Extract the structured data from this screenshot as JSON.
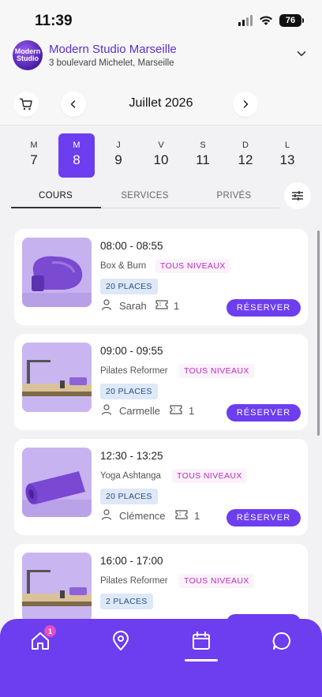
{
  "status": {
    "time": "11:39",
    "battery": "76"
  },
  "studio": {
    "name": "Modern Studio Marseille",
    "address": "3 boulevard Michelet, Marseille",
    "logo_line1": "Modern",
    "logo_line2": "Studio"
  },
  "calendar": {
    "month": "Juillet 2026",
    "days": [
      {
        "name": "M",
        "num": "7",
        "active": false
      },
      {
        "name": "M",
        "num": "8",
        "active": true
      },
      {
        "name": "J",
        "num": "9",
        "active": false
      },
      {
        "name": "V",
        "num": "10",
        "active": false
      },
      {
        "name": "S",
        "num": "11",
        "active": false
      },
      {
        "name": "D",
        "num": "12",
        "active": false
      },
      {
        "name": "L",
        "num": "13",
        "active": false
      }
    ]
  },
  "tabs": [
    {
      "label": "COURS",
      "active": true
    },
    {
      "label": "SERVICES",
      "active": false
    },
    {
      "label": "PRIVÉS",
      "active": false
    }
  ],
  "classes": [
    {
      "time": "08:00 - 08:55",
      "course": "Box & Burn",
      "level": "TOUS NIVEAUX",
      "places": "20 PLACES",
      "coach": "Sarah",
      "tickets": "1",
      "action": "RÉSERVER",
      "image": "boxing-glove"
    },
    {
      "time": "09:00 - 09:55",
      "course": "Pilates Reformer",
      "level": "TOUS NIVEAUX",
      "places": "20 PLACES",
      "coach": "Carmelle",
      "tickets": "1",
      "action": "RÉSERVER",
      "image": "reformer"
    },
    {
      "time": "12:30 - 13:25",
      "course": "Yoga Ashtanga",
      "level": "TOUS NIVEAUX",
      "places": "20 PLACES",
      "coach": "Clémence",
      "tickets": "1",
      "action": "RÉSERVER",
      "image": "yoga-mat"
    },
    {
      "time": "16:00 - 17:00",
      "course": "Pilates Reformer",
      "level": "TOUS NIVEAUX",
      "places": "2 PLACES",
      "coach": "",
      "tickets": "",
      "action": "",
      "image": "reformer"
    }
  ],
  "nav": {
    "items": [
      "home-icon",
      "location-icon",
      "calendar-icon",
      "chat-icon"
    ],
    "badge": "1",
    "active": "calendar-icon"
  },
  "colors": {
    "accent": "#6c3ef0",
    "studio_name": "#5b2fc9",
    "level": "#c02ac2",
    "places_bg": "#dde8f8",
    "badge": "#e44fc2"
  }
}
